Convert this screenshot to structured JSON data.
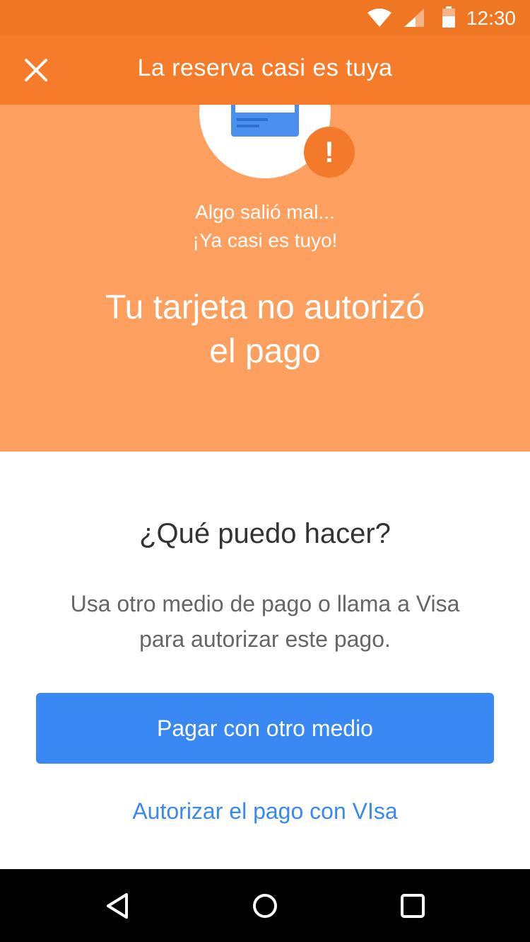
{
  "status_bar": {
    "time": "12:30",
    "icons": [
      "wifi-icon",
      "signal-icon",
      "battery-icon"
    ]
  },
  "app_bar": {
    "title": "La reserva casi es tuya",
    "close_icon": "close-icon"
  },
  "hero": {
    "subtitle_line1": "Algo salió mal...",
    "subtitle_line2": "¡Ya casi es tuyo!",
    "headline_line1": "Tu tarjeta no autorizó",
    "headline_line2": "el pago",
    "badge": "!"
  },
  "content": {
    "question": "¿Qué puedo hacer?",
    "desc_line1": "Usa otro medio de pago o llama a Visa",
    "desc_line2": "para autorizar este pago.",
    "primary_button": "Pagar con otro medio",
    "link_button": "Autorizar el pago con VIsa"
  },
  "nav": {
    "back_icon": "back-icon",
    "home_icon": "home-icon",
    "recents_icon": "recents-icon"
  },
  "colors": {
    "status_bar": "#ef7623",
    "app_bar": "#f67b2b",
    "hero": "#fda05f",
    "primary": "#3a88f4",
    "badge": "#f47a2b"
  }
}
